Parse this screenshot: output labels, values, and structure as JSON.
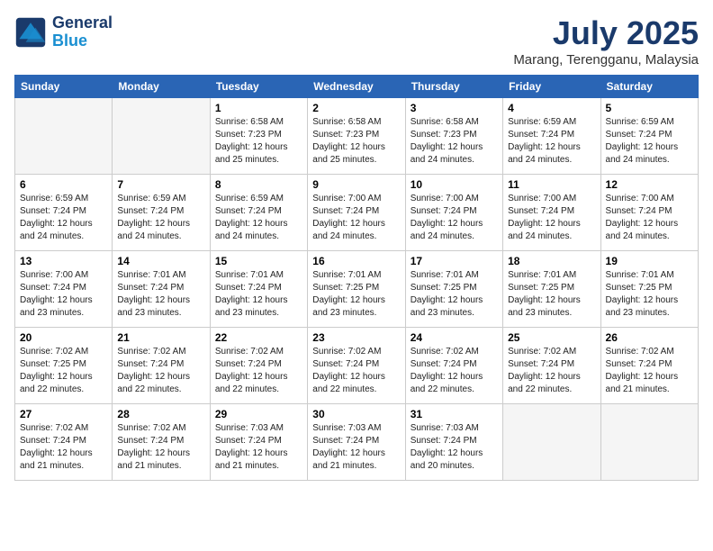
{
  "header": {
    "logo_line1": "General",
    "logo_line2": "Blue",
    "month": "July 2025",
    "location": "Marang, Terengganu, Malaysia"
  },
  "weekdays": [
    "Sunday",
    "Monday",
    "Tuesday",
    "Wednesday",
    "Thursday",
    "Friday",
    "Saturday"
  ],
  "weeks": [
    [
      {
        "day": "",
        "info": ""
      },
      {
        "day": "",
        "info": ""
      },
      {
        "day": "1",
        "info": "Sunrise: 6:58 AM\nSunset: 7:23 PM\nDaylight: 12 hours and 25 minutes."
      },
      {
        "day": "2",
        "info": "Sunrise: 6:58 AM\nSunset: 7:23 PM\nDaylight: 12 hours and 25 minutes."
      },
      {
        "day": "3",
        "info": "Sunrise: 6:58 AM\nSunset: 7:23 PM\nDaylight: 12 hours and 24 minutes."
      },
      {
        "day": "4",
        "info": "Sunrise: 6:59 AM\nSunset: 7:24 PM\nDaylight: 12 hours and 24 minutes."
      },
      {
        "day": "5",
        "info": "Sunrise: 6:59 AM\nSunset: 7:24 PM\nDaylight: 12 hours and 24 minutes."
      }
    ],
    [
      {
        "day": "6",
        "info": "Sunrise: 6:59 AM\nSunset: 7:24 PM\nDaylight: 12 hours and 24 minutes."
      },
      {
        "day": "7",
        "info": "Sunrise: 6:59 AM\nSunset: 7:24 PM\nDaylight: 12 hours and 24 minutes."
      },
      {
        "day": "8",
        "info": "Sunrise: 6:59 AM\nSunset: 7:24 PM\nDaylight: 12 hours and 24 minutes."
      },
      {
        "day": "9",
        "info": "Sunrise: 7:00 AM\nSunset: 7:24 PM\nDaylight: 12 hours and 24 minutes."
      },
      {
        "day": "10",
        "info": "Sunrise: 7:00 AM\nSunset: 7:24 PM\nDaylight: 12 hours and 24 minutes."
      },
      {
        "day": "11",
        "info": "Sunrise: 7:00 AM\nSunset: 7:24 PM\nDaylight: 12 hours and 24 minutes."
      },
      {
        "day": "12",
        "info": "Sunrise: 7:00 AM\nSunset: 7:24 PM\nDaylight: 12 hours and 24 minutes."
      }
    ],
    [
      {
        "day": "13",
        "info": "Sunrise: 7:00 AM\nSunset: 7:24 PM\nDaylight: 12 hours and 23 minutes."
      },
      {
        "day": "14",
        "info": "Sunrise: 7:01 AM\nSunset: 7:24 PM\nDaylight: 12 hours and 23 minutes."
      },
      {
        "day": "15",
        "info": "Sunrise: 7:01 AM\nSunset: 7:24 PM\nDaylight: 12 hours and 23 minutes."
      },
      {
        "day": "16",
        "info": "Sunrise: 7:01 AM\nSunset: 7:25 PM\nDaylight: 12 hours and 23 minutes."
      },
      {
        "day": "17",
        "info": "Sunrise: 7:01 AM\nSunset: 7:25 PM\nDaylight: 12 hours and 23 minutes."
      },
      {
        "day": "18",
        "info": "Sunrise: 7:01 AM\nSunset: 7:25 PM\nDaylight: 12 hours and 23 minutes."
      },
      {
        "day": "19",
        "info": "Sunrise: 7:01 AM\nSunset: 7:25 PM\nDaylight: 12 hours and 23 minutes."
      }
    ],
    [
      {
        "day": "20",
        "info": "Sunrise: 7:02 AM\nSunset: 7:25 PM\nDaylight: 12 hours and 22 minutes."
      },
      {
        "day": "21",
        "info": "Sunrise: 7:02 AM\nSunset: 7:24 PM\nDaylight: 12 hours and 22 minutes."
      },
      {
        "day": "22",
        "info": "Sunrise: 7:02 AM\nSunset: 7:24 PM\nDaylight: 12 hours and 22 minutes."
      },
      {
        "day": "23",
        "info": "Sunrise: 7:02 AM\nSunset: 7:24 PM\nDaylight: 12 hours and 22 minutes."
      },
      {
        "day": "24",
        "info": "Sunrise: 7:02 AM\nSunset: 7:24 PM\nDaylight: 12 hours and 22 minutes."
      },
      {
        "day": "25",
        "info": "Sunrise: 7:02 AM\nSunset: 7:24 PM\nDaylight: 12 hours and 22 minutes."
      },
      {
        "day": "26",
        "info": "Sunrise: 7:02 AM\nSunset: 7:24 PM\nDaylight: 12 hours and 21 minutes."
      }
    ],
    [
      {
        "day": "27",
        "info": "Sunrise: 7:02 AM\nSunset: 7:24 PM\nDaylight: 12 hours and 21 minutes."
      },
      {
        "day": "28",
        "info": "Sunrise: 7:02 AM\nSunset: 7:24 PM\nDaylight: 12 hours and 21 minutes."
      },
      {
        "day": "29",
        "info": "Sunrise: 7:03 AM\nSunset: 7:24 PM\nDaylight: 12 hours and 21 minutes."
      },
      {
        "day": "30",
        "info": "Sunrise: 7:03 AM\nSunset: 7:24 PM\nDaylight: 12 hours and 21 minutes."
      },
      {
        "day": "31",
        "info": "Sunrise: 7:03 AM\nSunset: 7:24 PM\nDaylight: 12 hours and 20 minutes."
      },
      {
        "day": "",
        "info": ""
      },
      {
        "day": "",
        "info": ""
      }
    ]
  ]
}
